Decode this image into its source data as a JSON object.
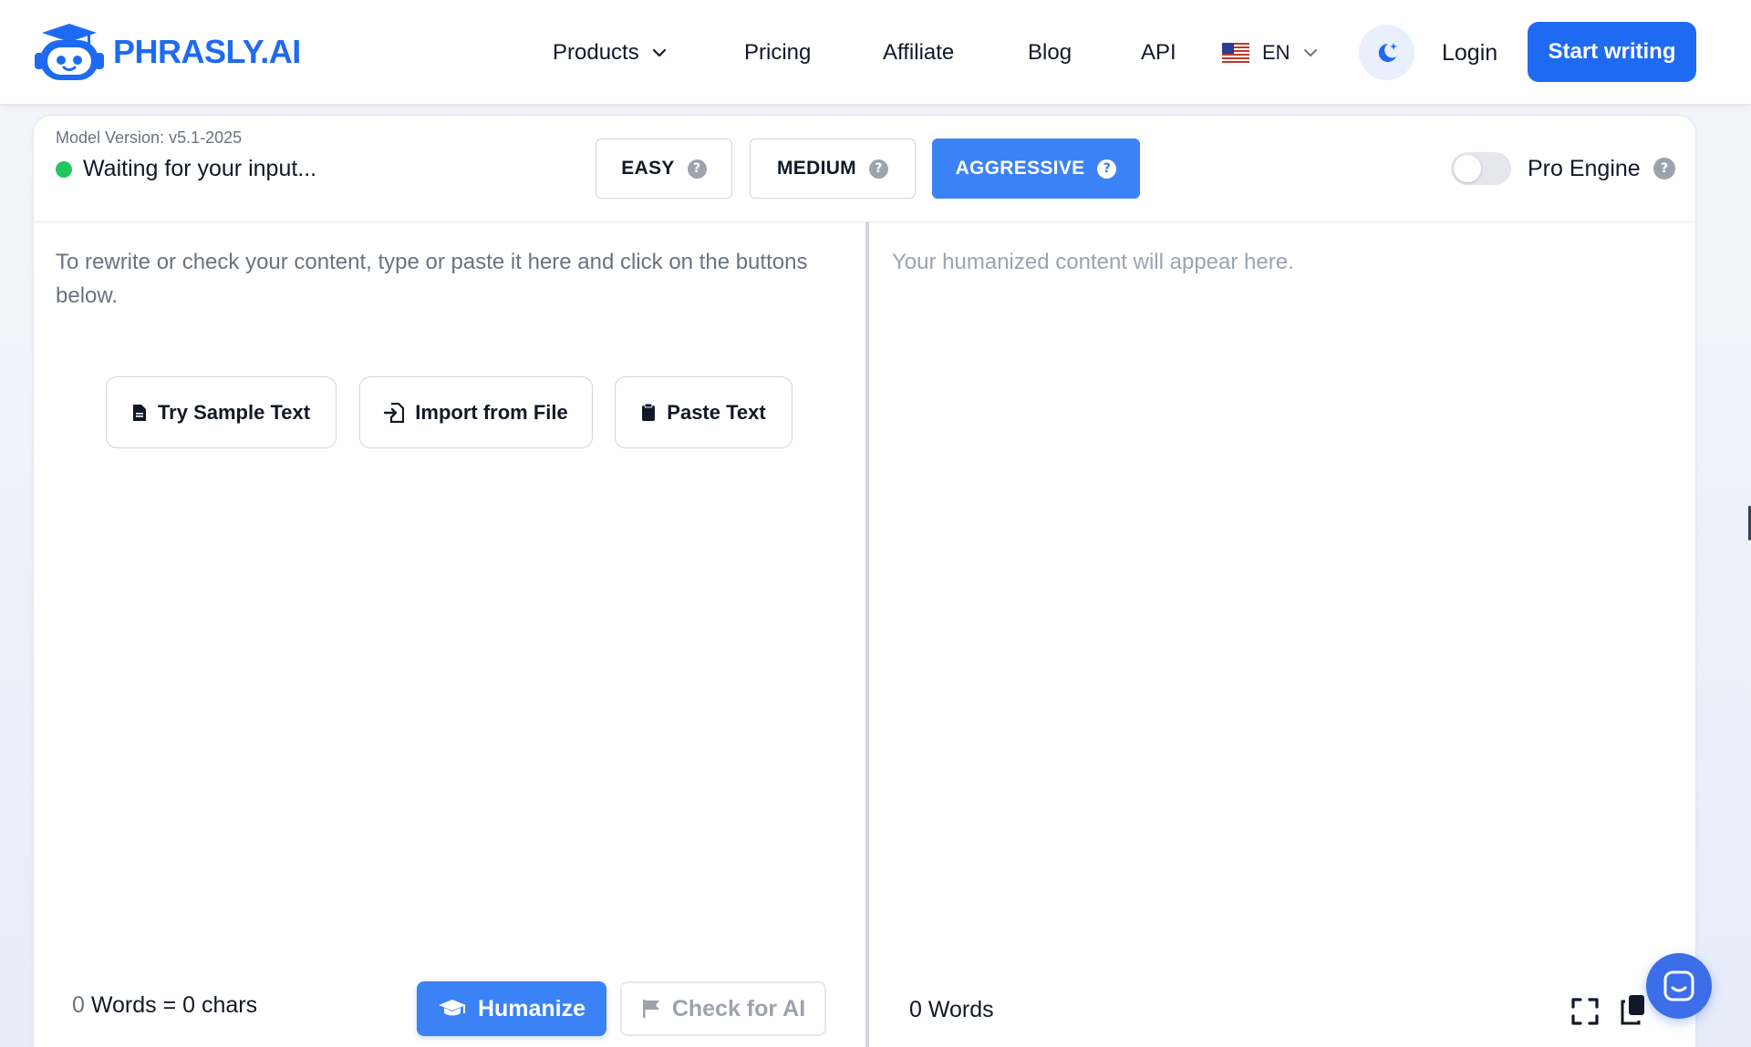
{
  "brand": {
    "name": "PHRASLY.AI",
    "color": "#1e6af3"
  },
  "nav": {
    "products": "Products",
    "pricing": "Pricing",
    "affiliate": "Affiliate",
    "blog": "Blog",
    "api": "API",
    "language": "EN",
    "login": "Login",
    "start_writing": "Start writing"
  },
  "header": {
    "model_version": "Model Version: v5.1-2025",
    "status": "Waiting for your input...",
    "status_color": "#22c55e",
    "modes": [
      {
        "label": "EASY",
        "selected": false
      },
      {
        "label": "MEDIUM",
        "selected": false
      },
      {
        "label": "AGGRESSIVE",
        "selected": true
      }
    ],
    "pro_engine_label": "Pro Engine",
    "pro_engine_on": false
  },
  "input": {
    "placeholder": "To rewrite or check your content, type or paste it here and click on the buttons below.",
    "buttons": {
      "sample": "Try Sample Text",
      "import": "Import from File",
      "paste": "Paste Text"
    },
    "word_count": "0",
    "words_label": "Words =",
    "char_count": "0",
    "chars_label": "chars",
    "humanize": "Humanize",
    "check_ai": "Check for AI"
  },
  "output": {
    "placeholder": "Your humanized content will appear here.",
    "word_count": "0 Words"
  },
  "icons": {
    "accent": "#3b82f6",
    "theme": "moon-sparkle-icon",
    "chat": "chat-icon"
  }
}
